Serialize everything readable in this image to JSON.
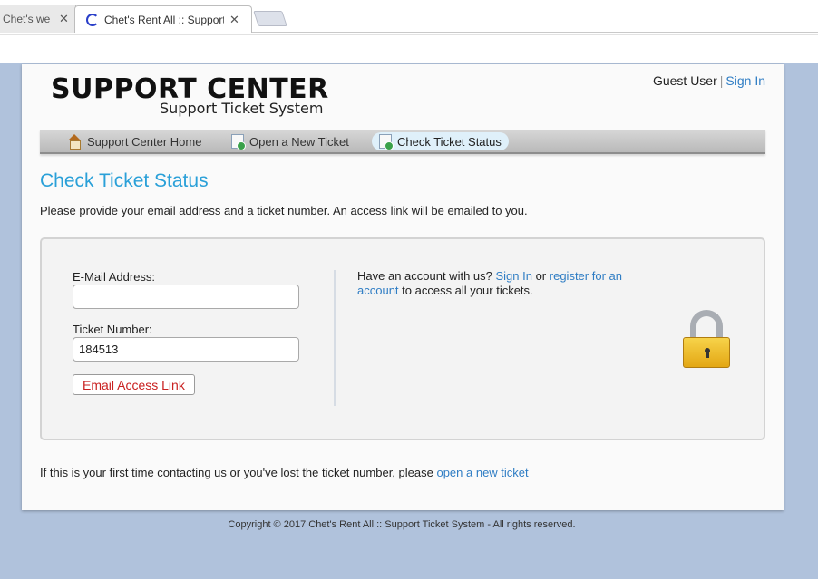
{
  "browser": {
    "tabs": [
      {
        "title": "Chet's we",
        "close": "✕"
      },
      {
        "title": "Chet's Rent All :: Support",
        "close": "✕"
      }
    ]
  },
  "header": {
    "logo_title": "SUPPORT CENTER",
    "logo_subtitle": "Support Ticket System",
    "user_label": "Guest User",
    "separator": "|",
    "sign_in": "Sign In"
  },
  "nav": {
    "items": [
      {
        "label": "Support Center Home",
        "icon": "home-icon"
      },
      {
        "label": "Open a New Ticket",
        "icon": "new-ticket-icon"
      },
      {
        "label": "Check Ticket Status",
        "icon": "ticket-status-icon",
        "active": true
      }
    ]
  },
  "main": {
    "heading": "Check Ticket Status",
    "intro": "Please provide your email address and a ticket number. An access link will be emailed to you.",
    "form": {
      "email_label": "E-Mail Address:",
      "email_value": "",
      "ticket_label": "Ticket Number:",
      "ticket_value": "184513",
      "submit_label": "Email Access Link"
    },
    "account": {
      "prefix": "Have an account with us? ",
      "sign_in": "Sign In",
      "middle": " or ",
      "register": "register for an account",
      "suffix": " to access all your tickets."
    },
    "footer_note": {
      "text": "If this is your first time contacting us or you've lost the ticket number, please ",
      "link": "open a new ticket"
    }
  },
  "copyright": "Copyright © 2017 Chet's Rent All :: Support Ticket System - All rights reserved.",
  "colors": {
    "accent": "#2aa0d8",
    "link": "#2f7dc4",
    "button_text": "#c92020",
    "background": "#b0c2dc"
  }
}
